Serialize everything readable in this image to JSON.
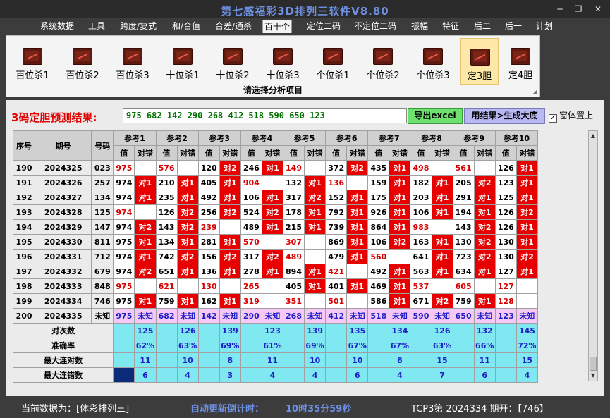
{
  "window": {
    "title": "第七感福彩3D排列三软件V8.80",
    "min": "─",
    "max": "❐",
    "close": "✕"
  },
  "menu": [
    "系统数据",
    "工具",
    "跨度/复式",
    "和/合值",
    "合差/通杀",
    "百十个",
    "定位二码",
    "不定位二码",
    "振幅",
    "特征",
    "后二",
    "后一",
    "计划"
  ],
  "menu_active": 5,
  "ribbon": {
    "buttons": [
      "百位杀1",
      "百位杀2",
      "百位杀3",
      "十位杀1",
      "十位杀2",
      "十位杀3",
      "个位杀1",
      "个位杀2",
      "个位杀3",
      "定3胆",
      "定4胆"
    ],
    "selected": 9,
    "caption": "请选择分析项目",
    "corner_icon": "dialog-launcher-icon"
  },
  "result": {
    "label": "3码定胆预测结果:",
    "value": "975 682 142 290 268 412 518 590 650 123",
    "excel_button": "导出excel",
    "generate_button": "用结果>生成大底",
    "topmost_label": "窗体置上",
    "topmost_checked": "✓"
  },
  "table": {
    "col_seq": "序号",
    "col_issue": "期号",
    "col_num": "号码",
    "refs": [
      "参考1",
      "参考2",
      "参考3",
      "参考4",
      "参考5",
      "参考6",
      "参考7",
      "参考8",
      "参考9",
      "参考10"
    ],
    "sub_val": "值",
    "sub_res": "对错",
    "rows": [
      {
        "seq": "190",
        "issue": "2024325",
        "num": "023",
        "cells": [
          [
            "975",
            ""
          ],
          [
            "576",
            ""
          ],
          [
            "120",
            "对2"
          ],
          [
            "246",
            "对1"
          ],
          [
            "149",
            ""
          ],
          [
            "372",
            "对2"
          ],
          [
            "435",
            "对1"
          ],
          [
            "498",
            ""
          ],
          [
            "561",
            ""
          ],
          [
            "126",
            "对1"
          ]
        ]
      },
      {
        "seq": "191",
        "issue": "2024326",
        "num": "257",
        "cells": [
          [
            "974",
            "对1"
          ],
          [
            "210",
            "对1"
          ],
          [
            "405",
            "对1"
          ],
          [
            "904",
            ""
          ],
          [
            "132",
            "对1"
          ],
          [
            "136",
            ""
          ],
          [
            "159",
            "对1"
          ],
          [
            "182",
            "对1"
          ],
          [
            "205",
            "对2"
          ],
          [
            "123",
            "对1"
          ]
        ]
      },
      {
        "seq": "192",
        "issue": "2024327",
        "num": "134",
        "cells": [
          [
            "974",
            "对1"
          ],
          [
            "235",
            "对1"
          ],
          [
            "492",
            "对1"
          ],
          [
            "106",
            "对1"
          ],
          [
            "317",
            "对2"
          ],
          [
            "152",
            "对1"
          ],
          [
            "175",
            "对1"
          ],
          [
            "203",
            "对1"
          ],
          [
            "291",
            "对1"
          ],
          [
            "125",
            "对1"
          ]
        ]
      },
      {
        "seq": "193",
        "issue": "2024328",
        "num": "125",
        "cells": [
          [
            "974",
            ""
          ],
          [
            "126",
            "对2"
          ],
          [
            "256",
            "对2"
          ],
          [
            "524",
            "对2"
          ],
          [
            "178",
            "对1"
          ],
          [
            "792",
            "对1"
          ],
          [
            "926",
            "对1"
          ],
          [
            "106",
            "对1"
          ],
          [
            "194",
            "对1"
          ],
          [
            "126",
            "对2"
          ]
        ]
      },
      {
        "seq": "194",
        "issue": "2024329",
        "num": "147",
        "cells": [
          [
            "974",
            "对2"
          ],
          [
            "143",
            "对2"
          ],
          [
            "239",
            ""
          ],
          [
            "489",
            "对1"
          ],
          [
            "215",
            "对1"
          ],
          [
            "739",
            "对1"
          ],
          [
            "864",
            "对1"
          ],
          [
            "983",
            ""
          ],
          [
            "143",
            "对2"
          ],
          [
            "126",
            "对1"
          ]
        ]
      },
      {
        "seq": "195",
        "issue": "2024330",
        "num": "811",
        "cells": [
          [
            "975",
            "对1"
          ],
          [
            "134",
            "对1"
          ],
          [
            "281",
            "对1"
          ],
          [
            "570",
            ""
          ],
          [
            "307",
            ""
          ],
          [
            "869",
            "对1"
          ],
          [
            "106",
            "对2"
          ],
          [
            "163",
            "对1"
          ],
          [
            "130",
            "对2"
          ],
          [
            "130",
            "对1"
          ]
        ]
      },
      {
        "seq": "196",
        "issue": "2024331",
        "num": "712",
        "cells": [
          [
            "974",
            "对1"
          ],
          [
            "742",
            "对2"
          ],
          [
            "156",
            "对2"
          ],
          [
            "317",
            "对2"
          ],
          [
            "489",
            ""
          ],
          [
            "479",
            "对1"
          ],
          [
            "560",
            ""
          ],
          [
            "641",
            "对1"
          ],
          [
            "723",
            "对2"
          ],
          [
            "130",
            "对2"
          ]
        ]
      },
      {
        "seq": "197",
        "issue": "2024332",
        "num": "679",
        "cells": [
          [
            "974",
            "对2"
          ],
          [
            "651",
            "对1"
          ],
          [
            "136",
            "对1"
          ],
          [
            "278",
            "对1"
          ],
          [
            "894",
            "对1"
          ],
          [
            "421",
            ""
          ],
          [
            "492",
            "对1"
          ],
          [
            "563",
            "对1"
          ],
          [
            "634",
            "对1"
          ],
          [
            "127",
            "对1"
          ]
        ]
      },
      {
        "seq": "198",
        "issue": "2024333",
        "num": "848",
        "cells": [
          [
            "975",
            ""
          ],
          [
            "621",
            ""
          ],
          [
            "130",
            ""
          ],
          [
            "265",
            ""
          ],
          [
            "405",
            "对1"
          ],
          [
            "401",
            "对1"
          ],
          [
            "469",
            "对1"
          ],
          [
            "537",
            ""
          ],
          [
            "605",
            ""
          ],
          [
            "127",
            ""
          ]
        ]
      },
      {
        "seq": "199",
        "issue": "2024334",
        "num": "746",
        "cells": [
          [
            "975",
            "对1"
          ],
          [
            "759",
            "对1"
          ],
          [
            "162",
            "对1"
          ],
          [
            "319",
            ""
          ],
          [
            "351",
            ""
          ],
          [
            "501",
            ""
          ],
          [
            "586",
            "对1"
          ],
          [
            "671",
            "对2"
          ],
          [
            "759",
            "对1"
          ],
          [
            "128",
            ""
          ]
        ]
      }
    ],
    "forecast": {
      "seq": "200",
      "issue": "2024335",
      "num": "未知",
      "vals": [
        "975",
        "682",
        "142",
        "290",
        "268",
        "412",
        "518",
        "590",
        "650",
        "123"
      ],
      "res": "未知"
    },
    "stats": [
      {
        "label": "对次数",
        "vals": [
          "125",
          "126",
          "139",
          "123",
          "139",
          "135",
          "134",
          "126",
          "132",
          "145"
        ]
      },
      {
        "label": "准确率",
        "vals": [
          "62%",
          "63%",
          "69%",
          "61%",
          "69%",
          "67%",
          "67%",
          "63%",
          "66%",
          "72%"
        ]
      },
      {
        "label": "最大连对数",
        "vals": [
          "11",
          "10",
          "8",
          "11",
          "10",
          "10",
          "8",
          "15",
          "11",
          "15"
        ]
      },
      {
        "label": "最大连错数",
        "vals": [
          "6",
          "4",
          "3",
          "4",
          "4",
          "6",
          "4",
          "7",
          "6",
          "4"
        ]
      }
    ]
  },
  "statusbar": {
    "data_source": "当前数据为：[体彩排列三]",
    "countdown_label": "自动更新倒计时：",
    "countdown": "10时35分59秒",
    "latest": "TCP3第  2024334  期开：【746】"
  },
  "colors": {
    "hit": "#e80000",
    "miss_value": "#d80000",
    "unknown_bg": "#f5c8f5",
    "stat_bg": "#80e8f0",
    "stat_text": "#1e1ec8",
    "result_text": "#007000",
    "label_red": "#e00000"
  }
}
